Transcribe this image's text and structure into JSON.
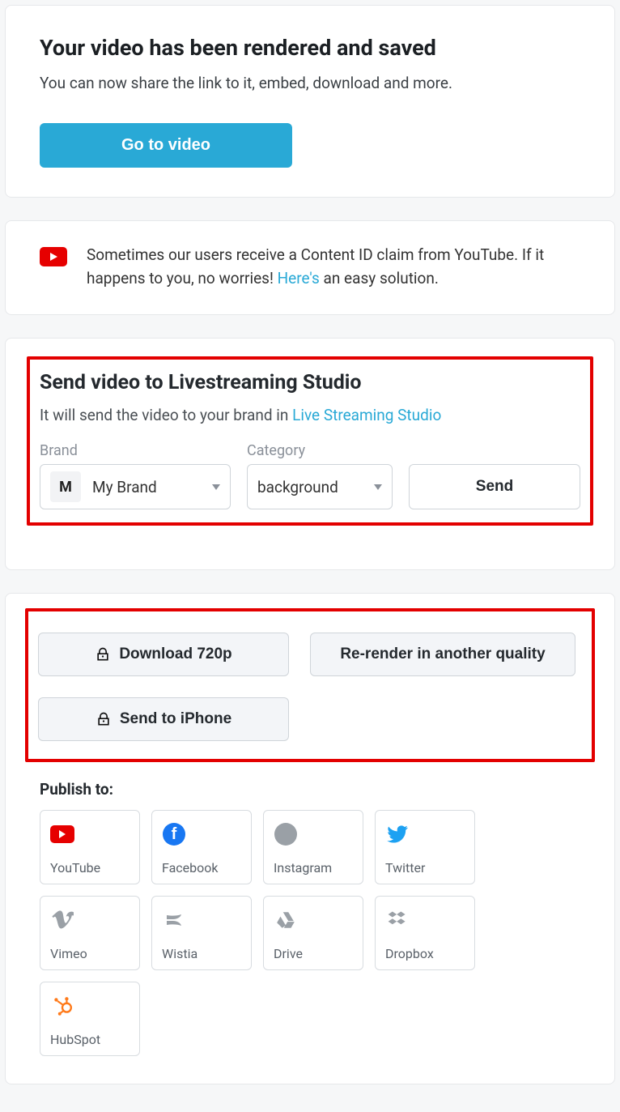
{
  "hero": {
    "title": "Your video has been rendered and saved",
    "subtitle": "You can now share the link to it, embed, download and more.",
    "cta": "Go to video"
  },
  "notice": {
    "text1": "Sometimes our users receive a Content ID claim from YouTube. If it happens to you, no worries! ",
    "link": "Here's",
    "text2": " an easy solution."
  },
  "livestream": {
    "title": "Send video to Livestreaming Studio",
    "sub_prefix": "It will send the video to your brand in ",
    "sub_link": "Live Streaming Studio",
    "brand_label": "Brand",
    "brand_badge": "M",
    "brand_value": "My Brand",
    "category_label": "Category",
    "category_value": "background",
    "send": "Send"
  },
  "actions": {
    "download": "Download 720p",
    "rerender": "Re-render in another quality",
    "send_iphone": "Send to iPhone"
  },
  "publish": {
    "label": "Publish to:",
    "items": [
      {
        "label": "YouTube"
      },
      {
        "label": "Facebook"
      },
      {
        "label": "Instagram"
      },
      {
        "label": "Twitter"
      },
      {
        "label": "Vimeo"
      },
      {
        "label": "Wistia"
      },
      {
        "label": "Drive"
      },
      {
        "label": "Dropbox"
      },
      {
        "label": "HubSpot"
      }
    ]
  }
}
